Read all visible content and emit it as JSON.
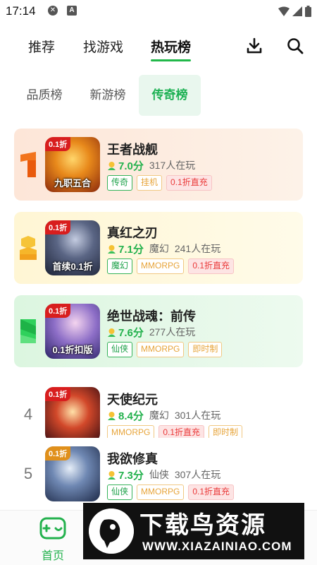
{
  "status_bar": {
    "time": "17:14"
  },
  "top_tabs": [
    "推荐",
    "找游戏",
    "热玩榜"
  ],
  "sub_tabs": [
    "品质榜",
    "新游榜",
    "传奇榜"
  ],
  "games": [
    {
      "rank": "1",
      "name": "王者战舰",
      "score": "7.0分",
      "players": "317人在玩",
      "genre": "",
      "ribbon": "0.1折",
      "banner": "九职五合",
      "tags": [
        "传奇",
        "挂机",
        "0.1折直充"
      ]
    },
    {
      "rank": "2",
      "name": "真红之刃",
      "score": "7.1分",
      "players": "241人在玩",
      "genre": "魔幻",
      "ribbon": "0.1折",
      "banner": "首续0.1折",
      "tags": [
        "魔幻",
        "MMORPG",
        "0.1折直充"
      ]
    },
    {
      "rank": "3",
      "name": "绝世战魂：前传",
      "score": "7.6分",
      "players": "277人在玩",
      "genre": "",
      "ribbon": "0.1折",
      "banner": "0.1折扣版",
      "tags": [
        "仙侠",
        "MMORPG",
        "即时制"
      ]
    },
    {
      "rank": "4",
      "name": "天使纪元",
      "score": "8.4分",
      "players": "301人在玩",
      "genre": "魔幻",
      "ribbon": "0.1折",
      "banner": "",
      "tags": [
        "MMORPG",
        "0.1折直充",
        "即时制"
      ]
    },
    {
      "rank": "5",
      "name": "我欲修真",
      "score": "7.3分",
      "players": "307人在玩",
      "genre": "仙侠",
      "ribbon": "0.1折",
      "banner": "",
      "tags": [
        "仙侠",
        "MMORPG",
        "0.1折直充"
      ]
    }
  ],
  "bottom_nav": {
    "home_label": "首页"
  },
  "watermark": {
    "title": "下载鸟资源",
    "url": "WWW.XIAZAINIAO.COM"
  }
}
